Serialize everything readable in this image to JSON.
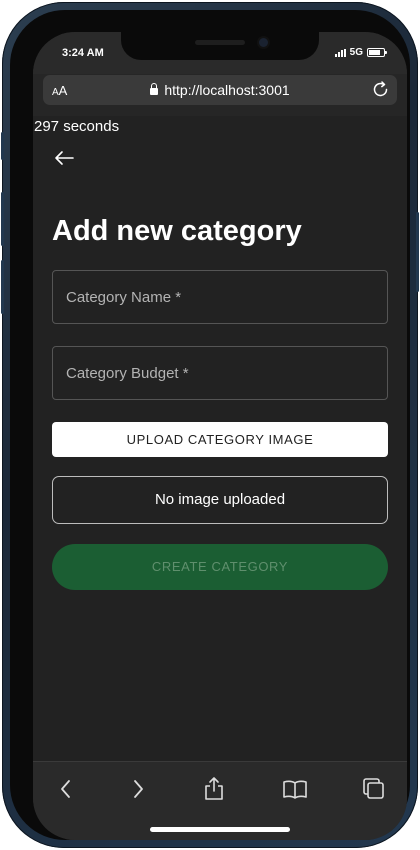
{
  "status_bar": {
    "time": "3:24 AM",
    "network": "5G",
    "signal_icon": "signal-bars-icon",
    "battery_icon": "battery-icon"
  },
  "browser": {
    "text_size_label": "AA",
    "url": "http://localhost:3001",
    "lock_icon": "lock-icon",
    "reload_icon": "reload-icon"
  },
  "page": {
    "timer_text": "297 seconds",
    "back_icon": "arrow-left-icon",
    "title": "Add new category",
    "category_name_label": "Category Name *",
    "category_budget_label": "Category Budget *",
    "upload_button_label": "UPLOAD CATEGORY IMAGE",
    "image_status_text": "No image uploaded",
    "create_button_label": "CREATE CATEGORY"
  },
  "toolbar": {
    "icons": [
      "back-icon",
      "forward-icon",
      "share-icon",
      "bookmarks-icon",
      "tabs-icon"
    ]
  },
  "colors": {
    "page_background": "#222222",
    "create_button_bg": "#1b5e33",
    "create_button_text": "#5f8f6d"
  }
}
